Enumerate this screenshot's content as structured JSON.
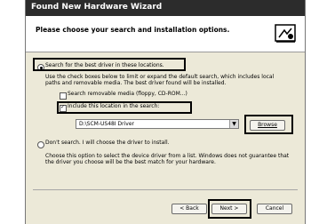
{
  "window": {
    "title": "Found New Hardware Wizard"
  },
  "header": {
    "title": "Please choose your search and installation options.",
    "icon": "hardware-wizard-icon"
  },
  "options": {
    "search_label": "Search for the best driver in these locations.",
    "search_desc_1": "Use the check boxes below to limit or expand the default search, which includes local",
    "search_desc_2": "paths and removable media. The best driver found will be installed.",
    "removable_label": "Search removable media (floppy, CD-ROM...)",
    "include_label": "Include this location in the search:",
    "path_value": "D:\\SCM-US48I Driver",
    "browse_label": "Browse",
    "dont_search_label": "Don't search. I will choose the driver to install.",
    "dont_desc_1": "Choose this option to select the device driver from a list.  Windows does not guarantee that",
    "dont_desc_2": "the driver you choose will be the best match for your hardware."
  },
  "buttons": {
    "back": "< Back",
    "next": "Next >",
    "cancel": "Cancel"
  },
  "state": {
    "search_selected": true,
    "removable_checked": false,
    "include_checked": true
  }
}
